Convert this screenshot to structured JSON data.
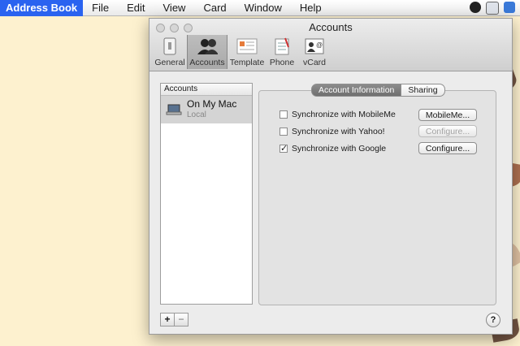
{
  "menubar": {
    "app_name": "Address Book",
    "items": [
      "File",
      "Edit",
      "View",
      "Card",
      "Window",
      "Help"
    ]
  },
  "window": {
    "title": "Accounts",
    "toolbar": [
      "General",
      "Accounts",
      "Template",
      "Phone",
      "vCard"
    ],
    "active_tab": "Accounts"
  },
  "accounts_list": {
    "header": "Accounts",
    "rows": [
      {
        "name": "On My Mac",
        "subtitle": "Local"
      }
    ],
    "add_label": "+",
    "remove_label": "−"
  },
  "panel": {
    "tabs": [
      "Account Information",
      "Sharing"
    ],
    "selected_tab": "Account Information",
    "options": [
      {
        "label": "Synchronize with MobileMe",
        "checked": false,
        "button": "MobileMe...",
        "enabled": true
      },
      {
        "label": "Synchronize with Yahoo!",
        "checked": false,
        "button": "Configure...",
        "enabled": false
      },
      {
        "label": "Synchronize with Google",
        "checked": true,
        "button": "Configure...",
        "enabled": true
      }
    ]
  },
  "help_label": "?",
  "colors": {
    "menubar_highlight": "#2a63f0",
    "desktop": "#fdf1cf"
  }
}
